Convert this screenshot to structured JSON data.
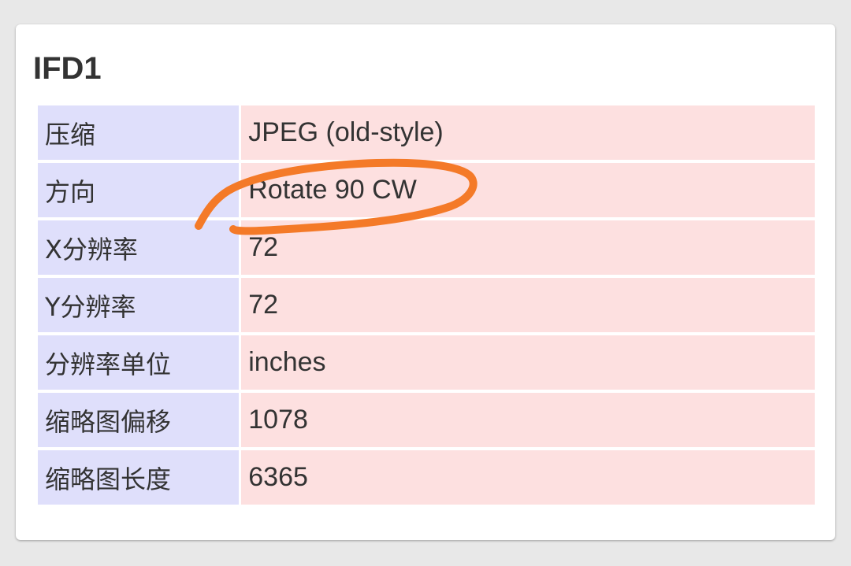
{
  "ifd1": {
    "title": "IFD1",
    "rows": [
      {
        "key": "压缩",
        "value": "JPEG (old-style)"
      },
      {
        "key": "方向",
        "value": "Rotate 90 CW"
      },
      {
        "key": "X分辨率",
        "value": "72"
      },
      {
        "key": "Y分辨率",
        "value": "72"
      },
      {
        "key": "分辨率单位",
        "value": "inches"
      },
      {
        "key": "缩略图偏移",
        "value": "1078"
      },
      {
        "key": "缩略图长度",
        "value": "6365"
      }
    ]
  },
  "colors": {
    "key_cell_bg": "#dfdffb",
    "value_cell_bg": "#fde0e0",
    "annotation_stroke": "#f47a28"
  }
}
